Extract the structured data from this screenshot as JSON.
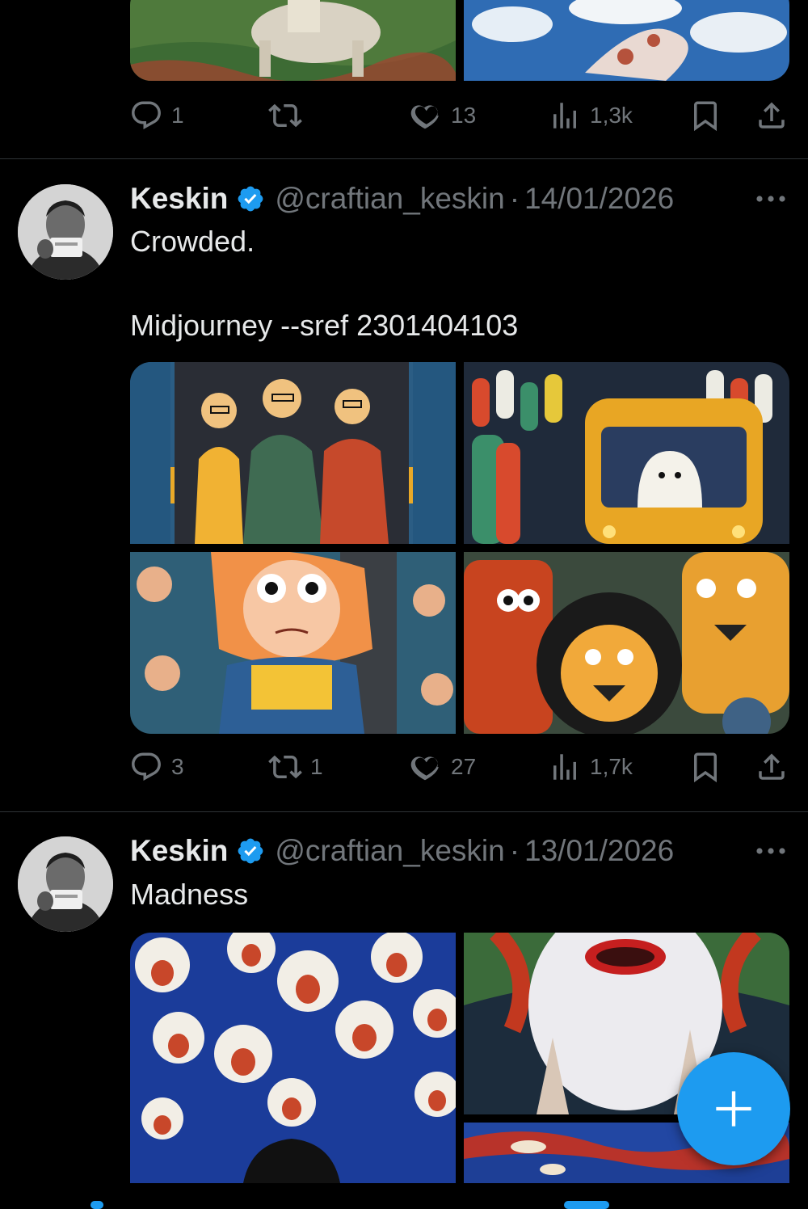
{
  "tweet0": {
    "replies": "1",
    "reposts": "",
    "likes": "13",
    "views": "1,3k"
  },
  "tweet1": {
    "name": "Keskin",
    "handle": "@craftian_keskin",
    "date": "14/01/2026",
    "line1": "Crowded.",
    "line2": "Midjourney --sref 2301404103",
    "replies": "3",
    "reposts": "1",
    "likes": "27",
    "views": "1,7k"
  },
  "tweet2": {
    "name": "Keskin",
    "handle": "@craftian_keskin",
    "date": "13/01/2026",
    "line1": "Madness"
  },
  "icons": {
    "reply": "reply-icon",
    "repost": "repost-icon",
    "like": "heart-icon",
    "views": "views-icon",
    "bookmark": "bookmark-icon",
    "share": "share-icon",
    "verified": "verified-badge-icon",
    "more": "more-options-icon",
    "compose": "plus-icon"
  },
  "colors": {
    "background": "#000000",
    "text": "#e7e9ea",
    "muted": "#71767b",
    "accent": "#1d9bf0",
    "divider": "#2f3336"
  }
}
